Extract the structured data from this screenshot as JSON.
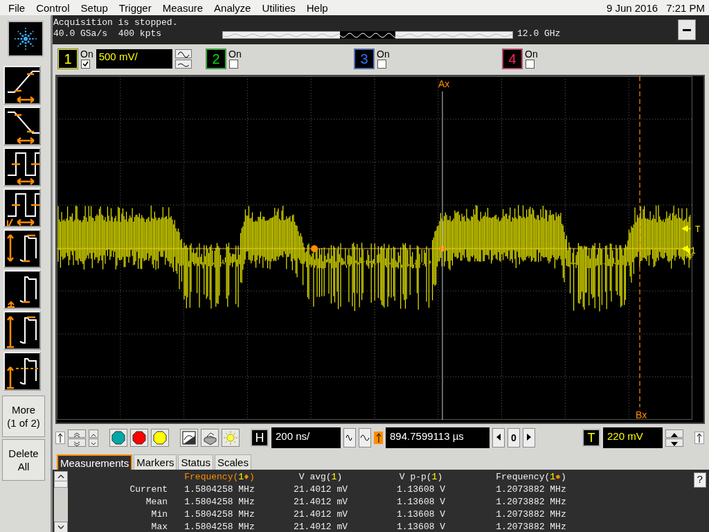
{
  "menu": [
    "File",
    "Control",
    "Setup",
    "Trigger",
    "Measure",
    "Analyze",
    "Utilities",
    "Help"
  ],
  "datetime": {
    "date": "9 Jun 2016",
    "time": "7:21 PM"
  },
  "status": {
    "message": "Acquisition is stopped.",
    "sample_rate": "40.0 GSa/s",
    "memory": "400 kpts",
    "bandwidth": "12.0 GHz"
  },
  "channels": [
    {
      "number": "1",
      "label": "On",
      "on": true,
      "color": "#ffff00",
      "scale": "500 mV/"
    },
    {
      "number": "2",
      "label": "On",
      "on": false,
      "color": "#00e000"
    },
    {
      "number": "3",
      "label": "On",
      "on": false,
      "color": "#3070ff"
    },
    {
      "number": "4",
      "label": "On",
      "on": false,
      "color": "#ff2060"
    }
  ],
  "side_buttons": [
    {
      "lines": [
        "More",
        "(1 of 2)"
      ]
    },
    {
      "lines": [
        "Delete",
        "All"
      ]
    }
  ],
  "screen": {
    "marker_a": "Ax",
    "marker_b": "Bx",
    "trigger_label": "T",
    "channel_label": "1"
  },
  "controls": {
    "h_label": "H",
    "timebase": "200 ns/",
    "position": "894.7599113 µs",
    "step": "0",
    "t_label": "T",
    "trigger_level": "220 mV"
  },
  "tabs": [
    {
      "label": "Measurements",
      "selected": true
    },
    {
      "label": "Markers",
      "selected": false
    },
    {
      "label": "Status",
      "selected": false
    },
    {
      "label": "Scales",
      "selected": false
    }
  ],
  "measurements": {
    "help": "?",
    "columns": [
      {
        "name": "Frequency(",
        "source": "1",
        "marker": "♦",
        "close": ")",
        "highlight": true
      },
      {
        "name": "V avg(",
        "source": "1",
        "close": ")",
        "highlight": false
      },
      {
        "name": "V p-p(",
        "source": "1",
        "close": ")",
        "highlight": false
      },
      {
        "name": "Frequency(",
        "source": "1",
        "marker": "●",
        "close": ")",
        "highlight": false
      }
    ],
    "rows": [
      {
        "label": "Current",
        "values": [
          "1.5804258 MHz",
          "21.4012 mV",
          "1.13608 V",
          "1.2073882 MHz"
        ]
      },
      {
        "label": "Mean",
        "values": [
          "1.5804258 MHz",
          "21.4012 mV",
          "1.13608 V",
          "1.2073882 MHz"
        ]
      },
      {
        "label": "Min",
        "values": [
          "1.5804258 MHz",
          "21.4012 mV",
          "1.13608 V",
          "1.2073882 MHz"
        ]
      },
      {
        "label": "Max",
        "values": [
          "1.5804258 MHz",
          "21.4012 mV",
          "1.13608 V",
          "1.2073882 MHz"
        ]
      }
    ]
  }
}
